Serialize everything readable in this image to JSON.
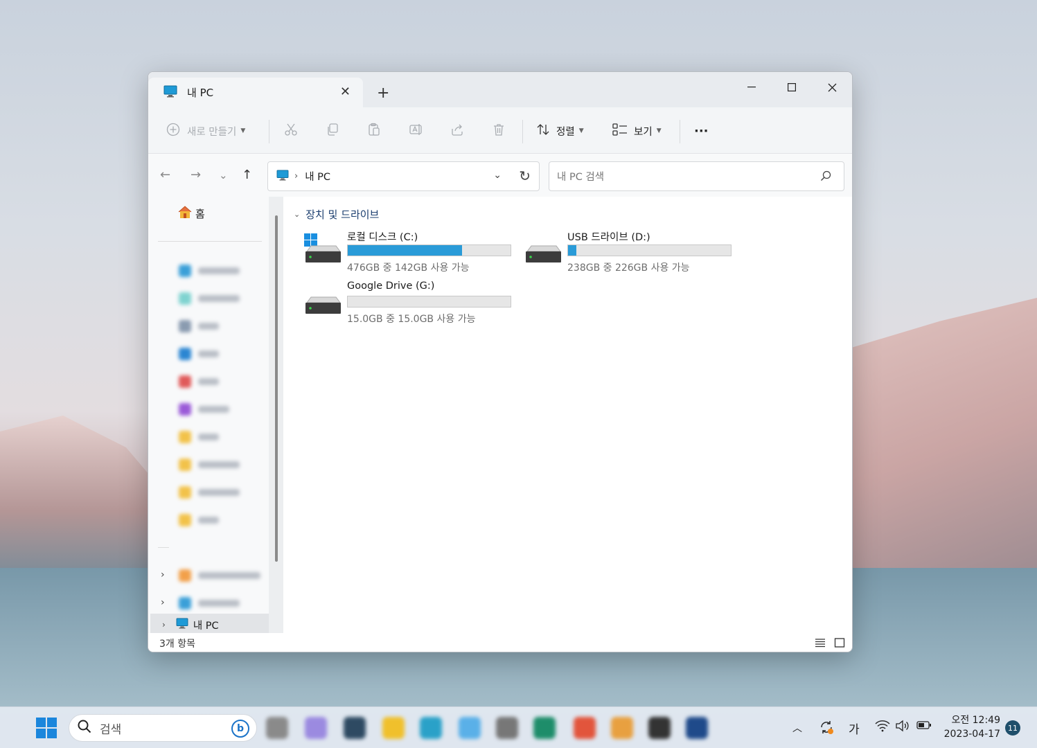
{
  "window": {
    "tab_title": "내 PC",
    "new_tab_symbol": "+",
    "close_tab_symbol": "✕",
    "controls": {
      "minimize": "—",
      "maximize": "☐",
      "close": "✕"
    }
  },
  "toolbar": {
    "new_label": "새로 만들기",
    "sort_label": "정렬",
    "view_label": "보기",
    "more_label": "···",
    "icons": [
      "cut-icon",
      "copy-icon",
      "paste-icon",
      "rename-icon",
      "share-icon",
      "delete-icon"
    ]
  },
  "navigation": {
    "back": "←",
    "forward": "→",
    "recent": "⌄",
    "up": "↑",
    "address_path": [
      "내 PC"
    ],
    "search_placeholder": "내 PC 검색"
  },
  "sidebar": {
    "home_label": "홈",
    "selected_label": "내 PC"
  },
  "content": {
    "group_title": "장치 및 드라이브",
    "drives": [
      {
        "name": "로컬 디스크 (C:)",
        "free_text": "476GB 중 142GB 사용 가능",
        "used_fraction": 0.7,
        "icon": "windows-drive-icon"
      },
      {
        "name": "USB 드라이브 (D:)",
        "free_text": "238GB 중 226GB 사용 가능",
        "used_fraction": 0.05,
        "icon": "usb-drive-icon"
      },
      {
        "name": "Google Drive (G:)",
        "free_text": "15.0GB 중 15.0GB 사용 가능",
        "used_fraction": 0.0,
        "icon": "drive-icon"
      }
    ]
  },
  "statusbar": {
    "count_label": "3개 항목"
  },
  "taskbar": {
    "search_label": "검색",
    "ime_label": "가",
    "time": "오전 12:49",
    "date": "2023-04-17",
    "notification_count": "11"
  },
  "colors": {
    "accent": "#2a9bd8",
    "group_header": "#1a3d6e"
  }
}
